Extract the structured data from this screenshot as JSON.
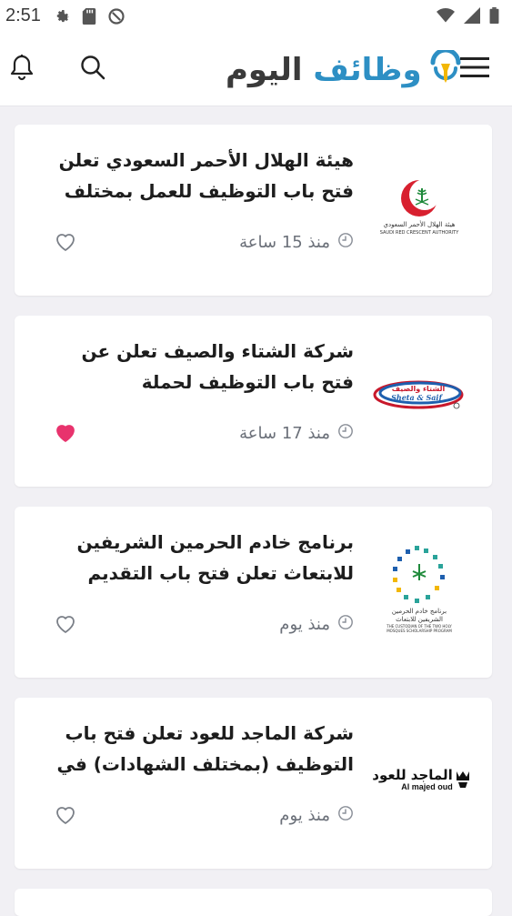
{
  "status": {
    "time": "2:51"
  },
  "header": {
    "logo_word1": "اليوم",
    "logo_word2": "وظائف"
  },
  "jobs": [
    {
      "title": "هيئة الهلال الأحمر السعودي تعلن فتح باب التوظيف للعمل بمختلف مناطق المملكة",
      "time": "منذ 15 ساعة",
      "favorited": false,
      "logo_name": "saudi-red-crescent-logo",
      "logo_caption_ar": "هيئة الهلال الأحمر السعودي",
      "logo_caption_en": "SAUDI RED CRESCENT AUTHORITY"
    },
    {
      "title": "شركة الشتاء والصيف تعلن عن فتح باب التوظيف لحملة البكالوريوس برواتب تصل ...",
      "time": "منذ 17 ساعة",
      "favorited": true,
      "logo_name": "sheta-and-saif-logo",
      "logo_caption_ar": "الشتاء والصيف",
      "logo_caption_en": "Sheta & Saif"
    },
    {
      "title": "برنامج خادم الحرمين الشريفين للابتعاث تعلن فتح باب التقديم على برامج الابتعاث ا...",
      "time": "منذ يوم",
      "favorited": false,
      "logo_name": "scholarship-program-logo",
      "logo_caption_ar": "برنامج خادم الحرمين الشريفين للابتعاث",
      "logo_caption_en": "THE CUSTODIAN OF THE TWO HOLY MOSQUES SCHOLARSHIP PROGRAM"
    },
    {
      "title": "شركة الماجد للعود تعلن فتح باب التوظيف (بمختلف الشهادات) في جميع مناطق المما...",
      "time": "منذ يوم",
      "favorited": false,
      "logo_name": "al-majed-oud-logo",
      "logo_caption_ar": "الماجد للعود",
      "logo_caption_en": "Al majed oud"
    }
  ],
  "colors": {
    "accent_blue": "#2d8fc4",
    "logo_yellow": "#f2b705",
    "heart_active": "#e8336d",
    "text_secondary": "#6b7079"
  }
}
